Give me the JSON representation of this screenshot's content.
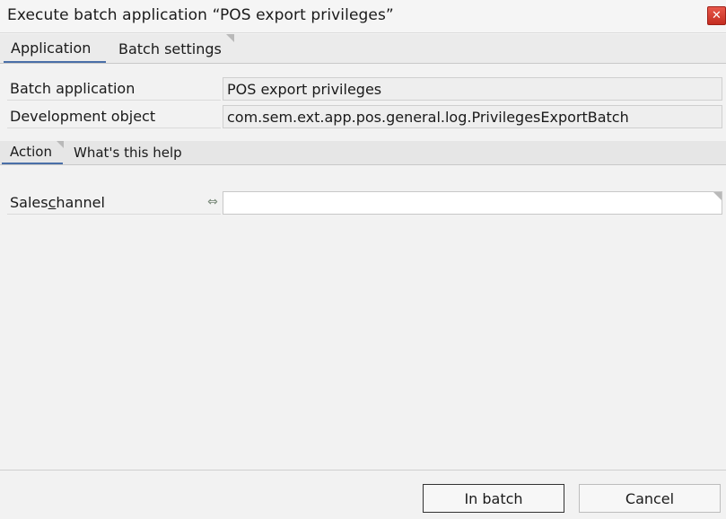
{
  "window": {
    "title": "Execute batch application “POS export privileges”",
    "close_label": "✕"
  },
  "tabs": [
    {
      "label": "Application",
      "active": true
    },
    {
      "label": "Batch settings",
      "active": false
    }
  ],
  "info": {
    "batch_application_label": "Batch application",
    "batch_application_value": "POS export privileges",
    "development_object_label": "Development object",
    "development_object_value": "com.sem.ext.app.pos.general.log.PrivilegesExportBatch"
  },
  "subtabs": [
    {
      "label": "Action",
      "active": true
    },
    {
      "label": "What's this help",
      "active": false
    }
  ],
  "form": {
    "sales_channel_label_pre": "Sales ",
    "sales_channel_label_accel": "c",
    "sales_channel_label_post": "hannel",
    "sales_channel_value": "",
    "link_icon": "link-arrows-icon"
  },
  "footer": {
    "in_batch_label": "In batch",
    "cancel_label": "Cancel"
  },
  "colors": {
    "accent": "#4a6fa8",
    "close_button": "#d43a2c"
  }
}
